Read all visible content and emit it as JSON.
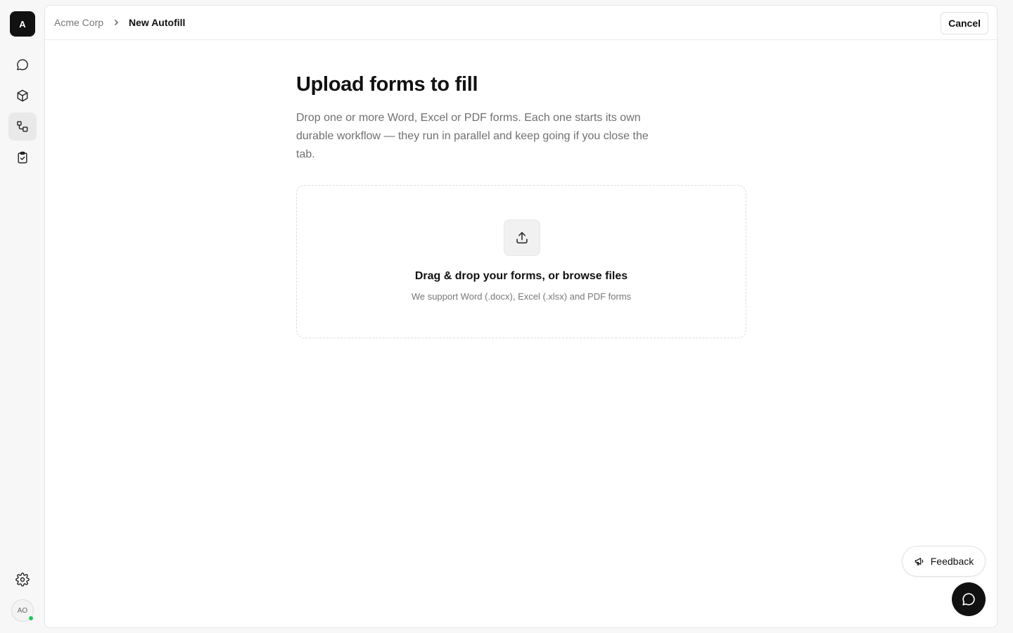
{
  "sidebar": {
    "logo_letter": "A",
    "avatar_initials": "AO",
    "items": [
      {
        "icon": "chat-icon"
      },
      {
        "icon": "cube-icon"
      },
      {
        "icon": "workflow-icon",
        "active": true
      },
      {
        "icon": "clipboard-check-icon"
      }
    ],
    "settings_icon": "gear-icon"
  },
  "header": {
    "breadcrumb_root": "Acme Corp",
    "breadcrumb_current": "New Autofill",
    "cancel_label": "Cancel"
  },
  "main": {
    "title": "Upload forms to fill",
    "description": "Drop one or more Word, Excel or PDF forms. Each one starts its own durable workflow — they run in parallel and keep going if you close the tab.",
    "dropzone": {
      "title": "Drag & drop your forms, or browse files",
      "subtitle": "We support Word (.docx), Excel (.xlsx) and PDF forms"
    }
  },
  "floating": {
    "feedback_label": "Feedback"
  },
  "colors": {
    "primary": "#111111",
    "status_online": "#22c55e",
    "muted_text": "#707070"
  }
}
